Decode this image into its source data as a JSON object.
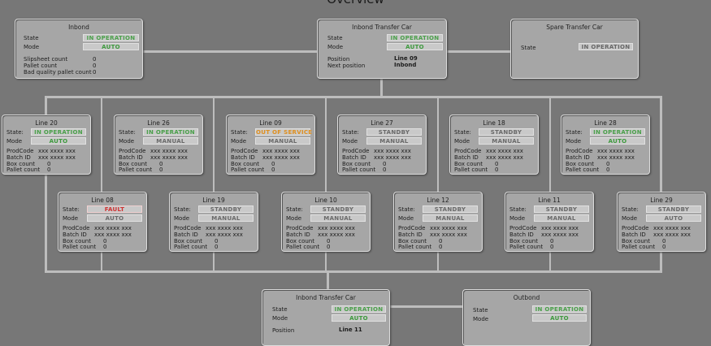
{
  "page_title": "Overview",
  "labels": {
    "state": "State",
    "state_colon": "State:",
    "mode": "Mode",
    "prodcode": "ProdCode",
    "batch": "Batch ID",
    "box": "Box count",
    "pallet": "Pallet count",
    "position": "Position",
    "next_position": "Next position",
    "slipsheet": "Slipsheet count",
    "bad_pallet": "Bad quality pallet count"
  },
  "inbond": {
    "title": "Inbond",
    "state": "IN OPERATION",
    "mode": "AUTO",
    "slipsheet": "0",
    "pallet": "0",
    "bad": "0"
  },
  "transfer_top": {
    "title": "Inbond Transfer Car",
    "state": "IN OPERATION",
    "mode": "AUTO",
    "position": "Line 09",
    "next": "Inbond"
  },
  "spare": {
    "title": "Spare Transfer Car",
    "state": "IN OPERATION"
  },
  "transfer_bottom": {
    "title": "Inbond Transfer Car",
    "state": "IN OPERATION",
    "mode": "AUTO",
    "position": "Line 11"
  },
  "outbond": {
    "title": "Outbond",
    "state": "IN OPERATION",
    "mode": "AUTO"
  },
  "row1": [
    {
      "title": "Line 20",
      "state": "IN OPERATION",
      "mode": "AUTO",
      "prod": "xxx xxxx xxx",
      "batch": "xxx xxxx xxx",
      "box": "0",
      "pallet": "0"
    },
    {
      "title": "Line 26",
      "state": "IN OPERATION",
      "mode": "MANUAL",
      "prod": "xxx xxxx xxx",
      "batch": "xxx xxxx xxx",
      "box": "0",
      "pallet": "0"
    },
    {
      "title": "Line 09",
      "state": "OUT OF SERVICE",
      "mode": "MANUAL",
      "prod": "xxx xxxx xxx",
      "batch": "xxx xxxx xxx",
      "box": "0",
      "pallet": "0"
    },
    {
      "title": "Line 27",
      "state": "STANDBY",
      "mode": "MANUAL",
      "prod": "xxx xxxx xxx",
      "batch": "xxx xxxx xxx",
      "box": "0",
      "pallet": "0"
    },
    {
      "title": "Line 18",
      "state": "STANDBY",
      "mode": "MANUAL",
      "prod": "xxx xxxx xxx",
      "batch": "xxx xxxx xxx",
      "box": "0",
      "pallet": "0"
    },
    {
      "title": "Line 28",
      "state": "IN OPERATION",
      "mode": "AUTO",
      "prod": "xxx xxxx xxx",
      "batch": "xxx xxxx xxx",
      "box": "0",
      "pallet": "0"
    }
  ],
  "row2": [
    {
      "title": "Line 08",
      "state": "FAULT",
      "mode": "AUTO",
      "prod": "xxx xxxx xxx",
      "batch": "xxx xxxx xxx",
      "box": "0",
      "pallet": "0"
    },
    {
      "title": "Line 19",
      "state": "STANDBY",
      "mode": "MANUAL",
      "prod": "xxx xxxx xxx",
      "batch": "xxx xxxx xxx",
      "box": "0",
      "pallet": "0"
    },
    {
      "title": "Line 10",
      "state": "STANDBY",
      "mode": "MANUAL",
      "prod": "xxx xxxx xxx",
      "batch": "xxx xxxx xxx",
      "box": "0",
      "pallet": "0"
    },
    {
      "title": "Line 12",
      "state": "STANDBY",
      "mode": "MANUAL",
      "prod": "xxx xxxx xxx",
      "batch": "xxx xxxx xxx",
      "box": "0",
      "pallet": "0"
    },
    {
      "title": "Line 11",
      "state": "STANDBY",
      "mode": "MANUAL",
      "prod": "xxx xxxx xxx",
      "batch": "xxx xxxx xxx",
      "box": "0",
      "pallet": "0"
    },
    {
      "title": "Line 29",
      "state": "STANDBY",
      "mode": "AUTO",
      "prod": "xxx xxxx xxx",
      "batch": "xxx xxxx xxx",
      "box": "0",
      "pallet": "0"
    }
  ]
}
